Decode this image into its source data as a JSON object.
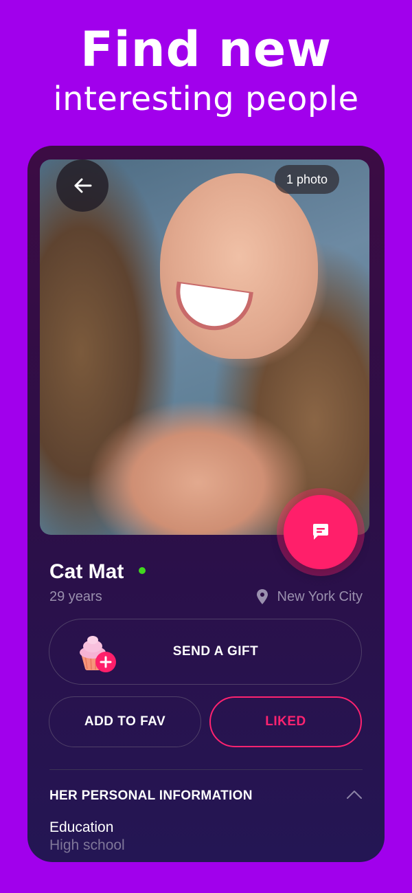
{
  "headline": {
    "title": "Find new",
    "subtitle": "interesting people"
  },
  "profile": {
    "photo_count": "1 photo",
    "name": "Cat Mat",
    "online": true,
    "age": "29 years",
    "location": "New York City"
  },
  "actions": {
    "gift_label": "SEND A GIFT",
    "fav_label": "ADD TO FAV",
    "liked_label": "LIKED"
  },
  "personal_info": {
    "section_title": "HER PERSONAL INFORMATION",
    "fields": [
      {
        "label": "Education",
        "value": "High school"
      }
    ]
  },
  "colors": {
    "background": "#a100ec",
    "accent": "#ff1f6a",
    "online": "#41d81f"
  },
  "icons": [
    "back-arrow-icon",
    "chat-icon",
    "location-pin-icon",
    "cupcake-gift-icon",
    "plus-icon",
    "chevron-up-icon"
  ]
}
